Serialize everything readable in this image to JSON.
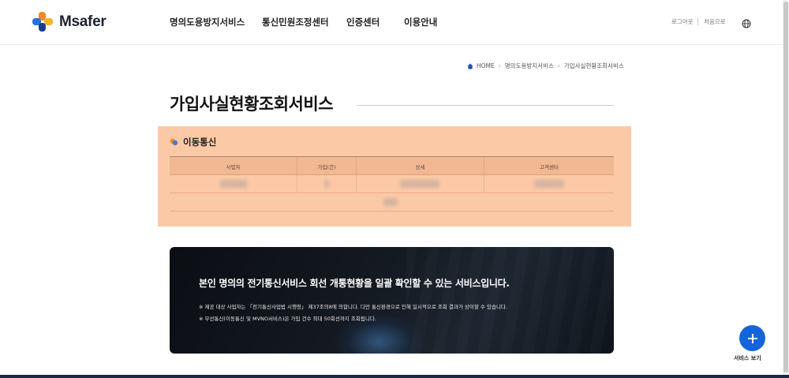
{
  "header": {
    "logo_text": "Msafer",
    "nav": [
      "명의도용방지서비스",
      "통신민원조정센터",
      "인증센터",
      "이용안내"
    ],
    "util_links": [
      "로그아웃",
      "처음으로"
    ],
    "brand_colors": {
      "orange": "#f08a24",
      "blue": "#2a6fdb",
      "dark": "#1c2230"
    }
  },
  "breadcrumb": [
    "HOME",
    "명의도용방지서비스",
    "가입사실현황조회서비스"
  ],
  "page_title": "가입사실현황조회서비스",
  "result": {
    "section_title": "이동통신",
    "columns": [
      "사업자",
      "가입(건)",
      "상세",
      "고객센터"
    ],
    "highlight_color": "#fcc9a6"
  },
  "banner": {
    "headline": "본인 명의의 전기통신서비스 회선 개통현황을 일괄 확인할 수 있는 서비스입니다.",
    "notes": [
      "※ 제공 대상 사업자는 「전기통신사업법 시행령」 제37조의8에 의합니다. 다만 통신환경으로 인해 일시적으로 조회 결과가 상이할 수 있습니다.",
      "※ 무선통신(이동통신 및 MVNO서비스)은 가입 건수 최대 50회선까지 조회됩니다."
    ]
  },
  "fab": {
    "label": "서비스 보기",
    "icon": "plus-icon",
    "color": "#1565d8"
  }
}
